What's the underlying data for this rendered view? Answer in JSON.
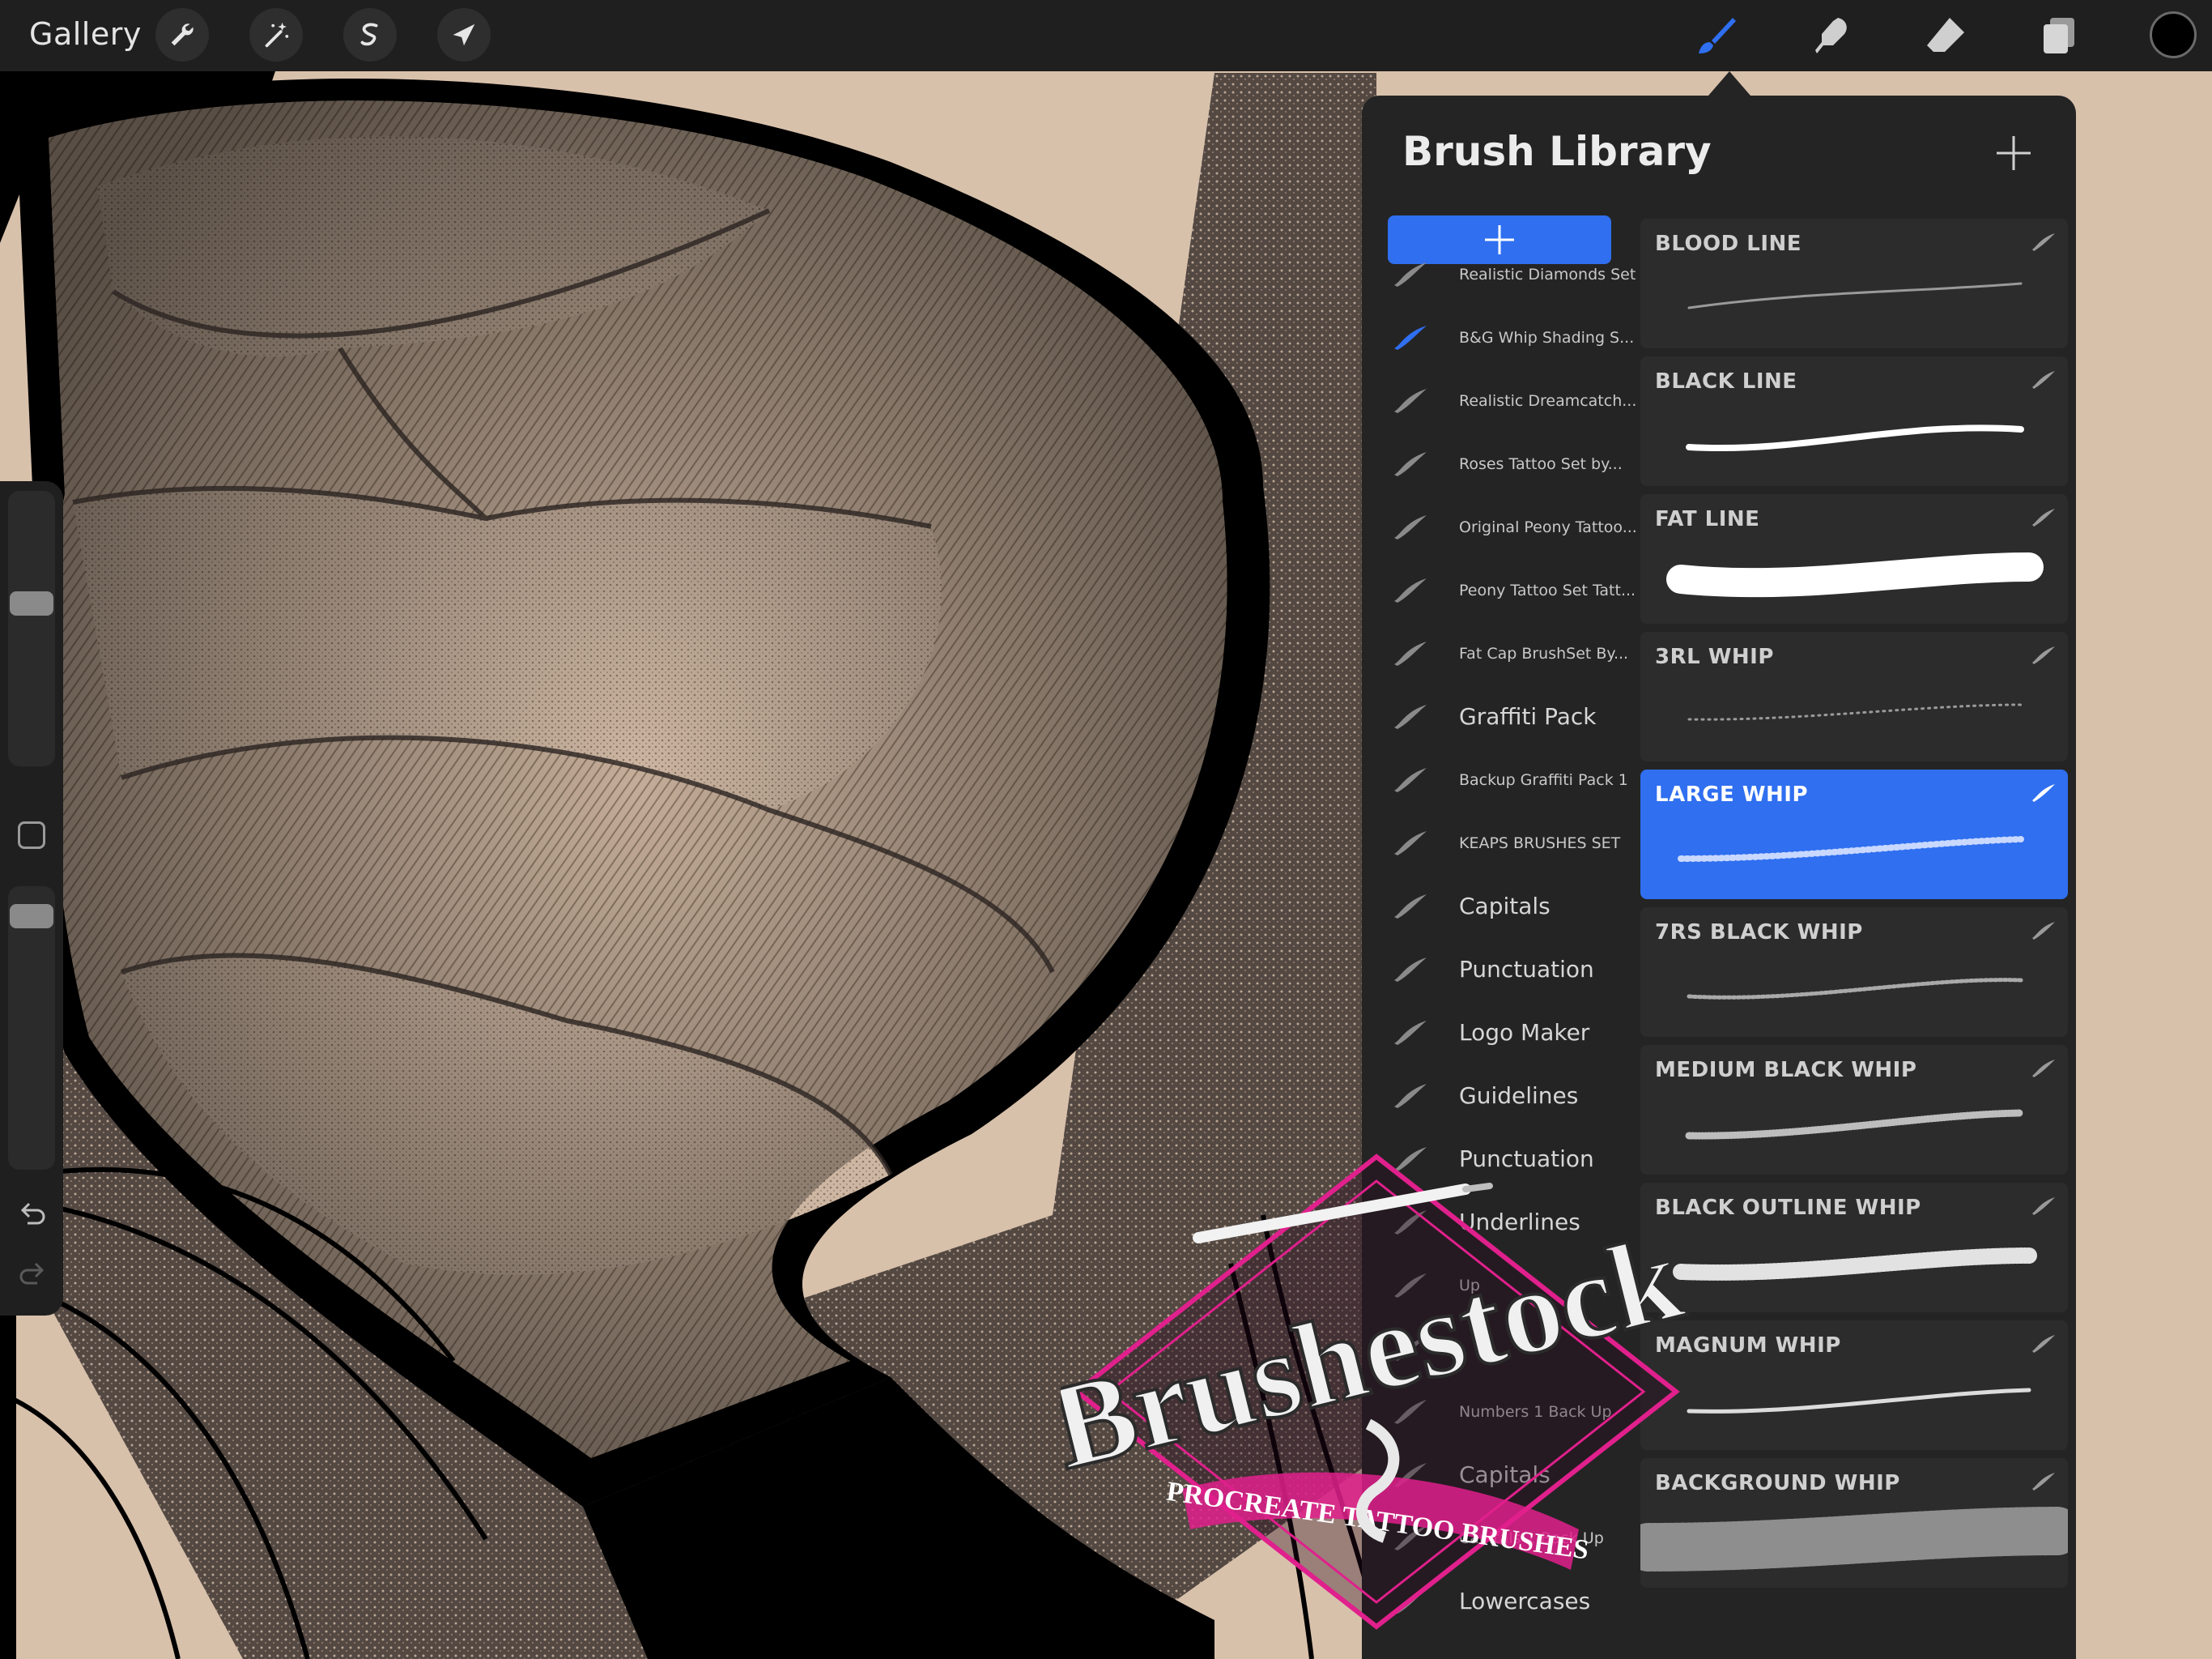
{
  "toolbar": {
    "gallery_label": "Gallery",
    "left_tools": [
      "wrench-icon",
      "magic-wand-icon",
      "selection-icon",
      "transform-arrow-icon"
    ],
    "right_tools": [
      "brush-icon",
      "smudge-icon",
      "eraser-icon",
      "layers-icon"
    ],
    "active_tool": "brush-icon",
    "current_color": "#000000"
  },
  "colors": {
    "accent": "#2f6ff0",
    "panel_bg": "#242424",
    "card_bg": "#2c2c2c"
  },
  "brush_library": {
    "title": "Brush Library",
    "add_brush_icon": "plus-icon",
    "add_set_icon": "plus-icon",
    "sets": [
      {
        "label": "Realistic Diamonds Set",
        "size": "small",
        "active": false
      },
      {
        "label": "B&G Whip Shading S...",
        "size": "small",
        "active": true
      },
      {
        "label": "Realistic Dreamcatch...",
        "size": "small",
        "active": false
      },
      {
        "label": "Roses Tattoo Set by...",
        "size": "small",
        "active": false
      },
      {
        "label": "Original Peony Tattoo...",
        "size": "small",
        "active": false
      },
      {
        "label": "Peony Tattoo Set Tatt...",
        "size": "small",
        "active": false
      },
      {
        "label": "Fat Cap BrushSet By...",
        "size": "small",
        "active": false
      },
      {
        "label": "Graffiti Pack",
        "size": "large",
        "active": false
      },
      {
        "label": "Backup Graffiti Pack 1",
        "size": "small",
        "active": false
      },
      {
        "label": "KEAPS BRUSHES SET",
        "size": "small",
        "active": false
      },
      {
        "label": "Capitals",
        "size": "large",
        "active": false
      },
      {
        "label": "Punctuation",
        "size": "large",
        "active": false
      },
      {
        "label": "Logo Maker",
        "size": "large",
        "active": false
      },
      {
        "label": "Guidelines",
        "size": "large",
        "active": false
      },
      {
        "label": "Punctuation",
        "size": "large",
        "active": false
      },
      {
        "label": "Underlines",
        "size": "large",
        "active": false
      },
      {
        "label": "Up",
        "size": "small",
        "active": false
      },
      {
        "label": "",
        "size": "small",
        "active": false
      },
      {
        "label": "Numbers 1 Back Up",
        "size": "small",
        "active": false
      },
      {
        "label": "Capitals",
        "size": "large",
        "active": false
      },
      {
        "label": "Capitals 1 Back Up",
        "size": "small",
        "active": false
      },
      {
        "label": "Lowercases",
        "size": "large",
        "active": false
      }
    ],
    "brushes": [
      {
        "name": "BLOOD LINE",
        "selected": false
      },
      {
        "name": "BLACK LINE",
        "selected": false
      },
      {
        "name": "FAT LINE",
        "selected": false
      },
      {
        "name": "3RL WHIP",
        "selected": false
      },
      {
        "name": "LARGE WHIP",
        "selected": true
      },
      {
        "name": "7RS BLACK WHIP",
        "selected": false
      },
      {
        "name": "MEDIUM BLACK WHIP",
        "selected": false
      },
      {
        "name": "BLACK OUTLINE WHIP",
        "selected": false
      },
      {
        "name": "MAGNUM WHIP",
        "selected": false
      },
      {
        "name": "BACKGROUND WHIP",
        "selected": false
      }
    ]
  },
  "watermark": {
    "brand": "Brushestock",
    "tagline": "PROCREATE TATTOO BRUSHES"
  }
}
